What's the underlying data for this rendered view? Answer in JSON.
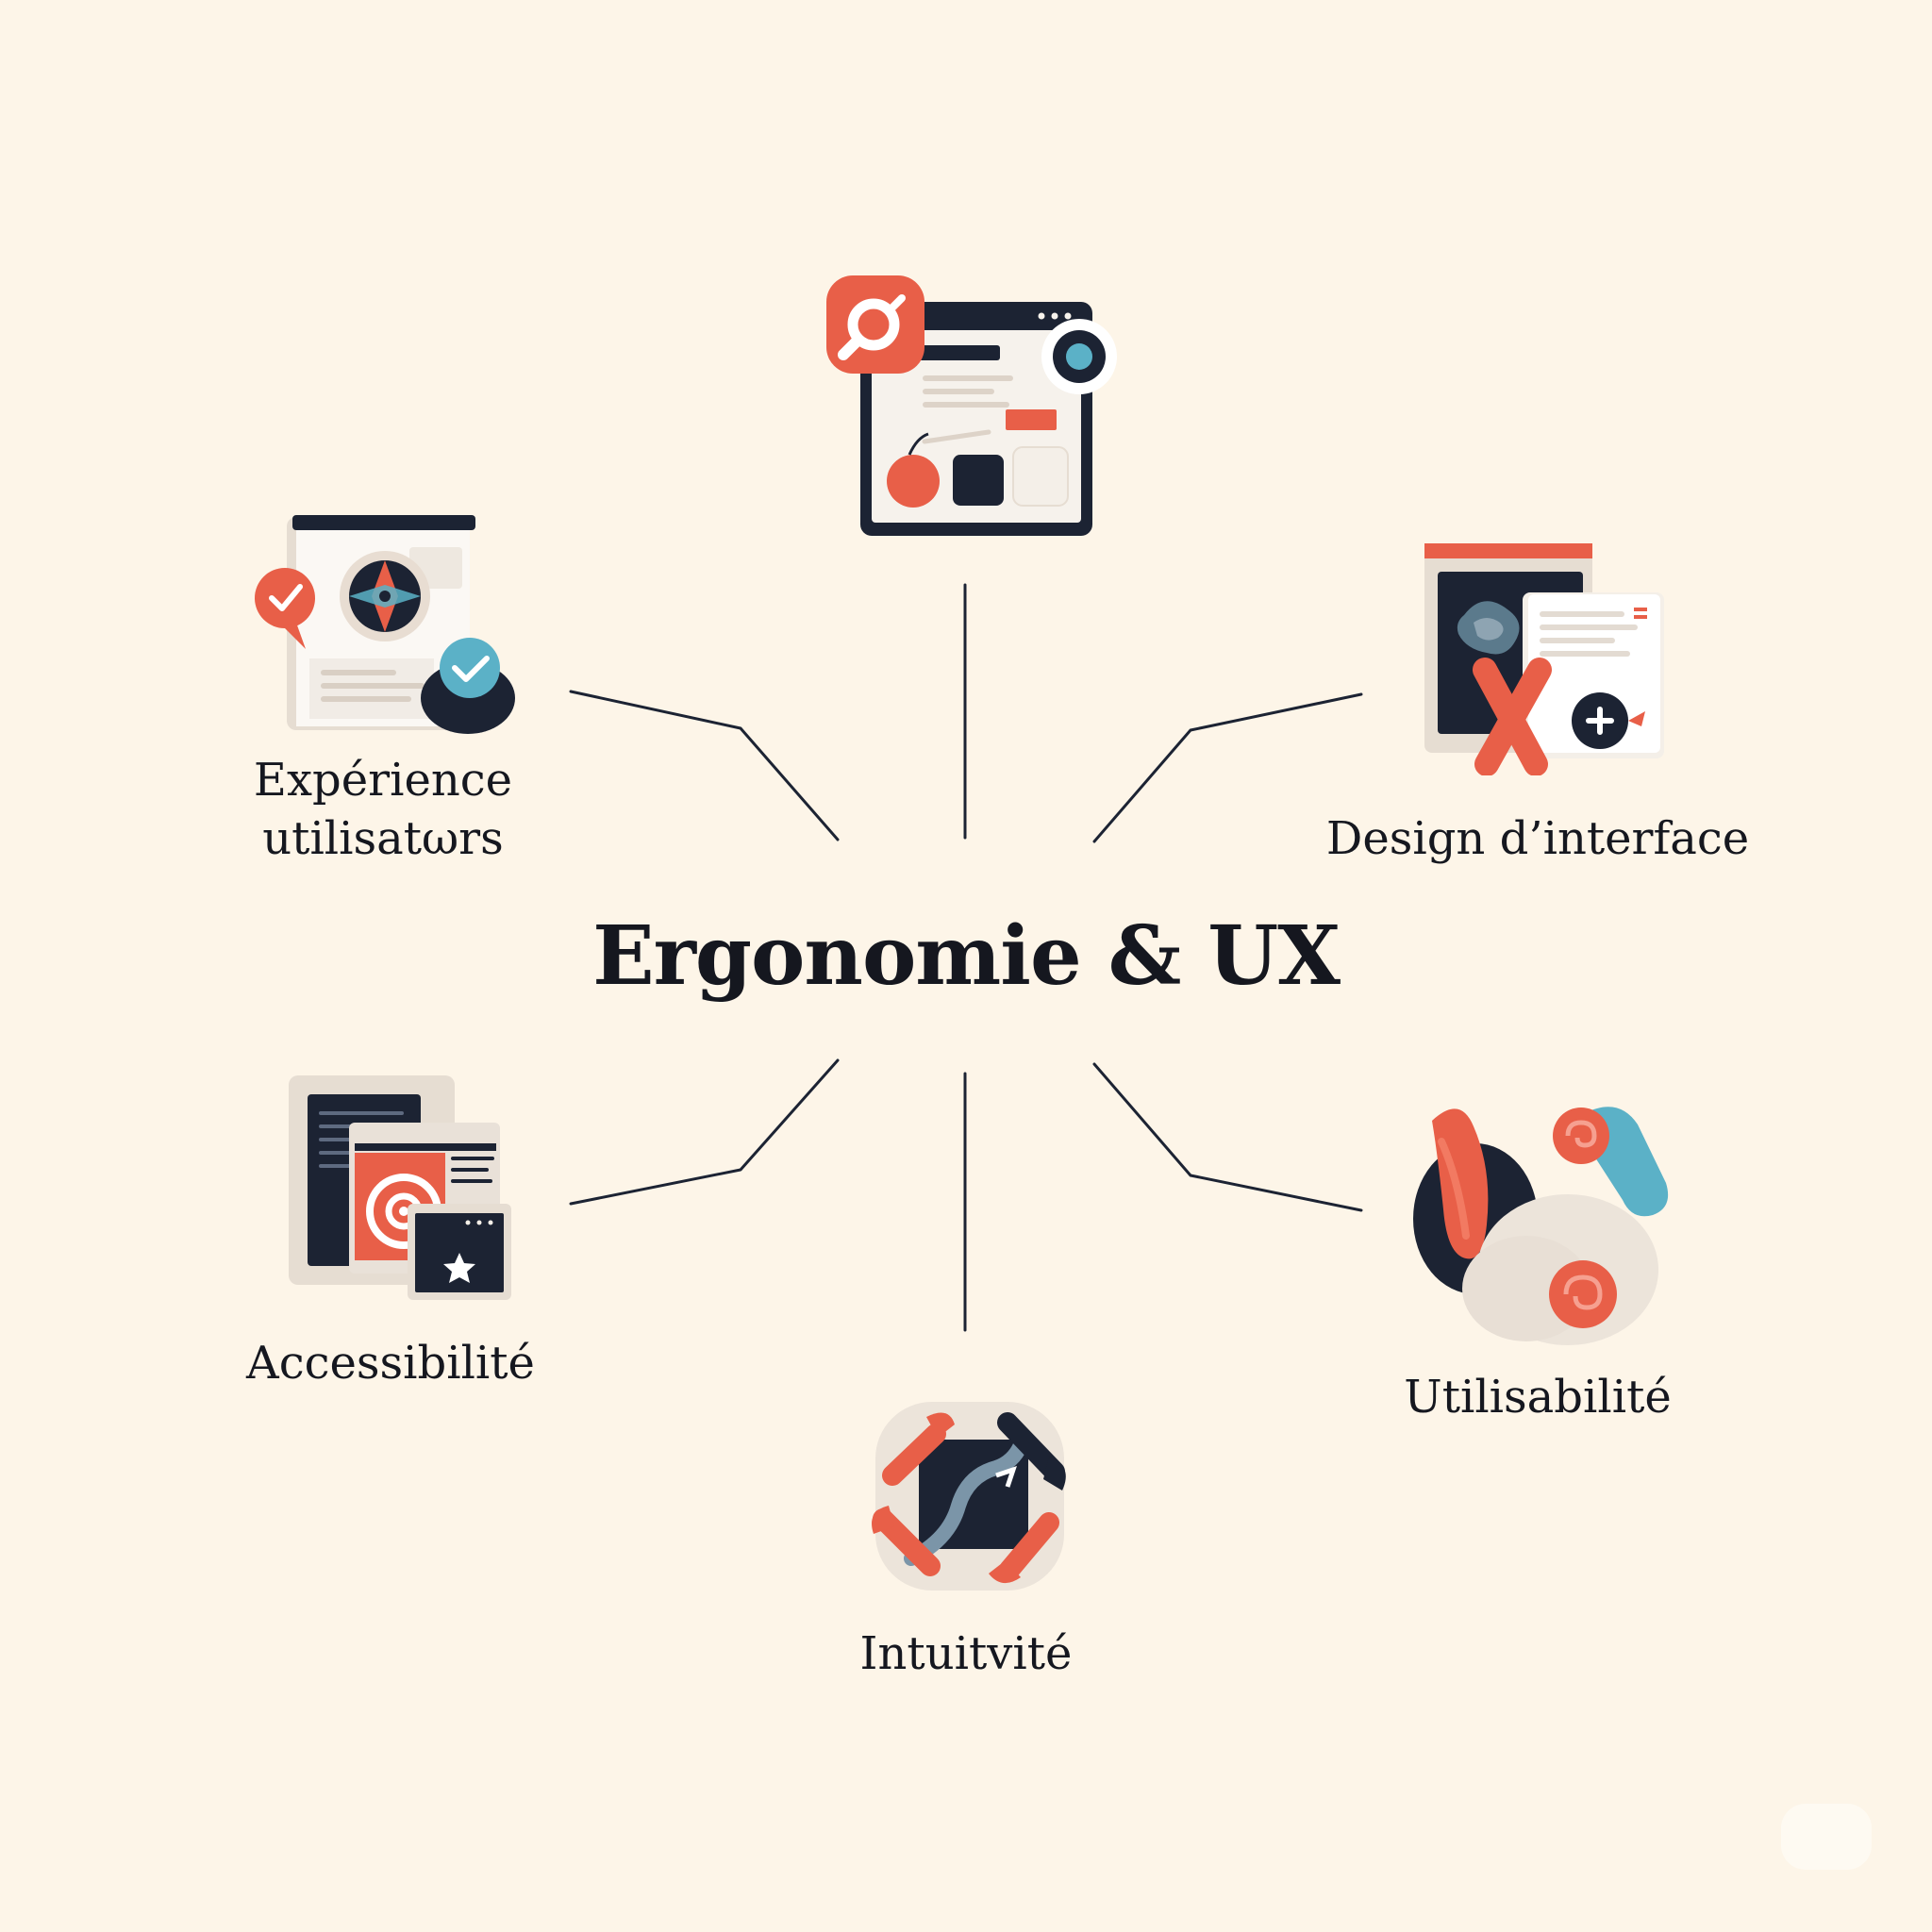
{
  "diagram": {
    "center": {
      "title": "Ergonomie & UX"
    },
    "nodes": {
      "top": {
        "icon": "browser-window-search-icon"
      },
      "experience": {
        "icon": "feedback-checkmark-window-icon",
        "label_line1": "Expérience",
        "label_line2": "utilisatωrs"
      },
      "design": {
        "icon": "design-canvas-tools-icon",
        "label": "Design d’interface"
      },
      "accessibility": {
        "icon": "accessible-documents-star-icon",
        "label": "Accessibilité"
      },
      "usability": {
        "icon": "usability-blobs-icon",
        "label": "Utilisabilité"
      },
      "intuitivity": {
        "icon": "intuitive-cycle-arrows-icon",
        "label": "Intuitvité"
      }
    },
    "colors": {
      "background": "#fdf5e8",
      "navy": "#1c2333",
      "coral": "#e85f48",
      "teal": "#5bb1c7",
      "beige": "#e8ddd2",
      "light": "#f4f2ef"
    }
  }
}
